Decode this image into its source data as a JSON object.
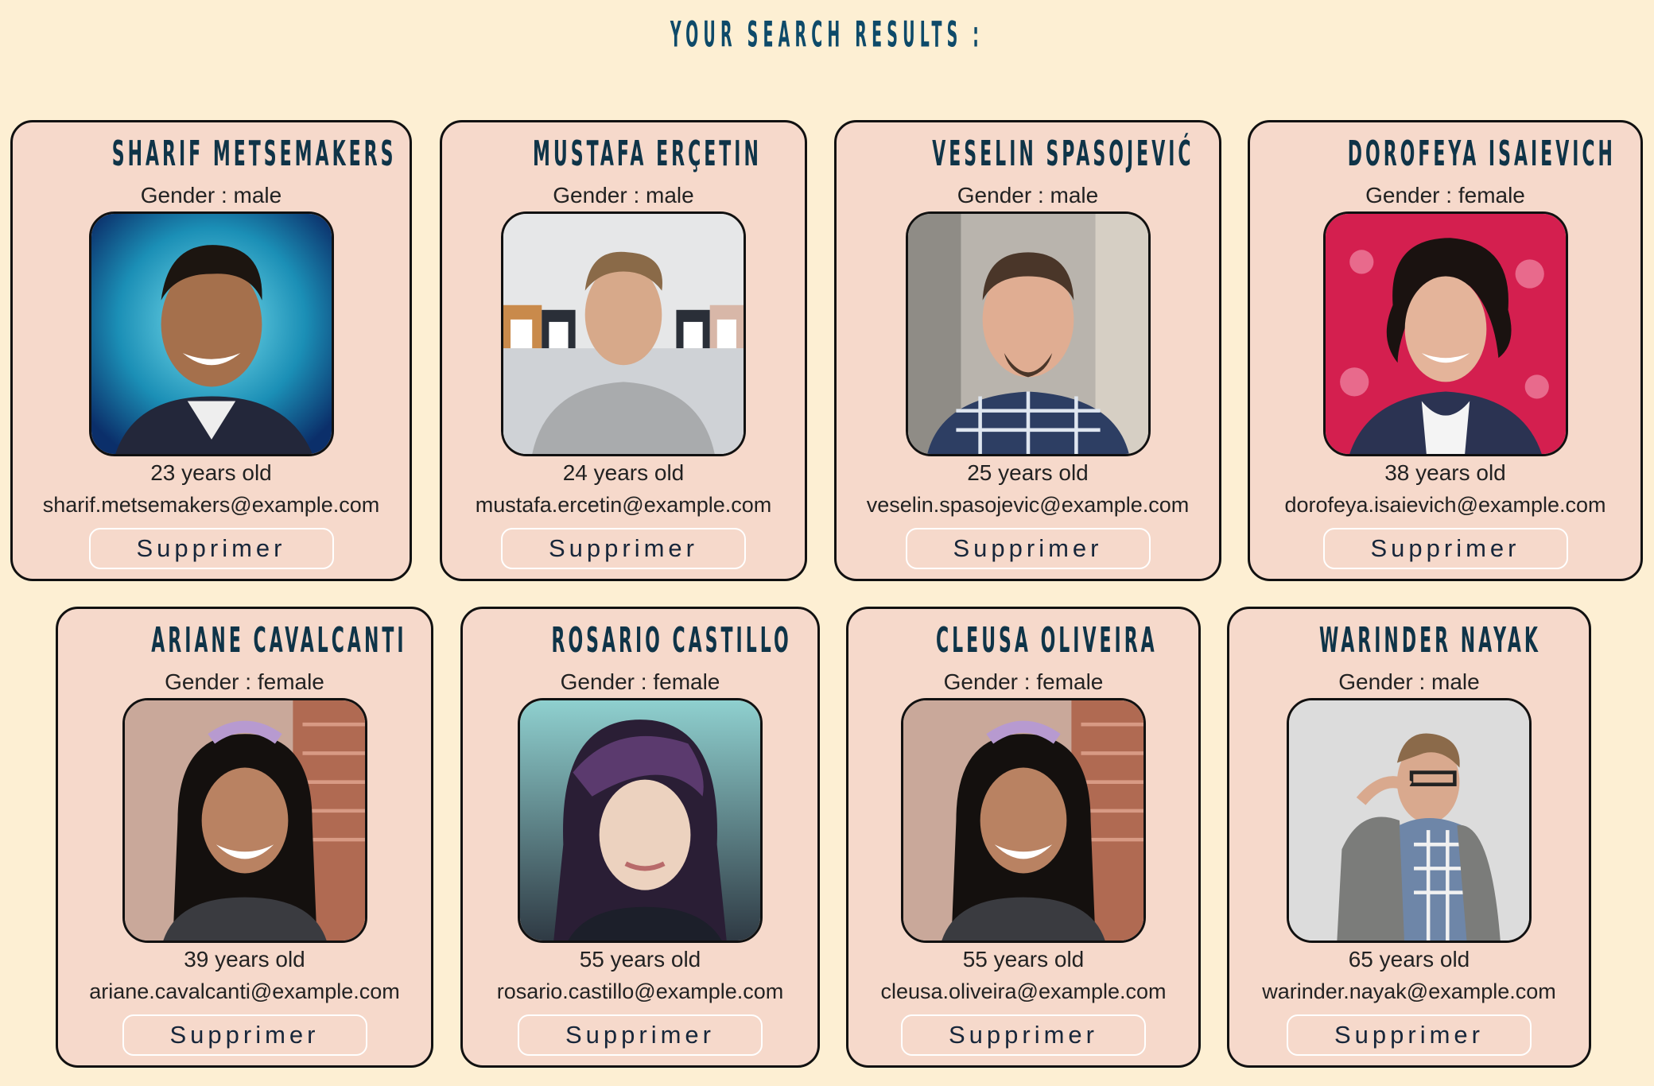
{
  "header": {
    "title": "Your search results :"
  },
  "delete_label": "Supprimer",
  "results": [
    {
      "name": "Sharif Metsemakers",
      "gender_text": "Gender : male",
      "age_text": "23 years old",
      "email": "sharif.metsemakers@example.com"
    },
    {
      "name": "Mustafa Erçetin",
      "gender_text": "Gender : male",
      "age_text": "24 years old",
      "email": "mustafa.ercetin@example.com"
    },
    {
      "name": "Veselin Spasojević",
      "gender_text": "Gender : male",
      "age_text": "25 years old",
      "email": "veselin.spasojevic@example.com"
    },
    {
      "name": "Dorofeya Isaievich",
      "gender_text": "Gender : female",
      "age_text": "38 years old",
      "email": "dorofeya.isaievich@example.com"
    },
    {
      "name": "Ariane Cavalcanti",
      "gender_text": "Gender : female",
      "age_text": "39 years old",
      "email": "ariane.cavalcanti@example.com"
    },
    {
      "name": "Rosario Castillo",
      "gender_text": "Gender : female",
      "age_text": "55 years old",
      "email": "rosario.castillo@example.com"
    },
    {
      "name": "Cleusa Oliveira",
      "gender_text": "Gender : female",
      "age_text": "55 years old",
      "email": "cleusa.oliveira@example.com"
    },
    {
      "name": "Warinder Nayak",
      "gender_text": "Gender : male",
      "age_text": "65 years old",
      "email": "warinder.nayak@example.com"
    }
  ]
}
